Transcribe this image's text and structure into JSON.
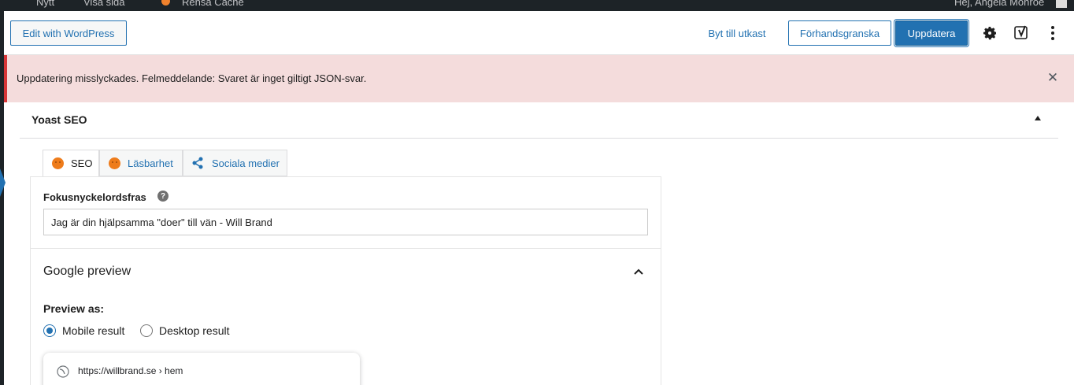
{
  "admin_bar": {
    "items": [
      "Nytt",
      "Visa sida",
      "Rensa Cache",
      "Hej, Angela Monroe"
    ]
  },
  "header": {
    "edit_with_label": "Edit with WordPress",
    "switch_to_draft_label": "Byt till utkast",
    "preview_label": "Förhandsgranska",
    "update_label": "Uppdatera",
    "settings_icon": "gear-icon",
    "yoast_icon": "yoast-y-icon",
    "more_icon": "vertical-ellipsis-icon"
  },
  "notice": {
    "message": "Uppdatering misslyckades. Felmeddelande: Svaret är inget giltigt JSON-svar.",
    "close_icon": "close-icon",
    "type": "error"
  },
  "yoast": {
    "panel_title": "Yoast SEO",
    "tabs": [
      {
        "label": "SEO",
        "icon": "orange-face-icon",
        "active": true
      },
      {
        "label": "Läsbarhet",
        "icon": "orange-face-icon",
        "active": false
      },
      {
        "label": "Sociala medier",
        "icon": "share-icon",
        "active": false
      }
    ],
    "focus_keyphrase": {
      "label": "Fokusnyckelordsfras",
      "value": "Jag är din hjälpsamma \"doer\" till vän - Will Brand",
      "help_icon": "question-icon"
    },
    "google_preview": {
      "title": "Google preview",
      "preview_as_label": "Preview as:",
      "options": [
        {
          "label": "Mobile result",
          "checked": true
        },
        {
          "label": "Desktop result",
          "checked": false
        }
      ],
      "url": "https://willbrand.se › hem"
    }
  },
  "colors": {
    "accent": "#2271b1",
    "notice_bg": "#f4dcdc",
    "notice_border": "#d63638",
    "admin_bar": "#1d2327",
    "seo_score": "#ee7c1b"
  }
}
